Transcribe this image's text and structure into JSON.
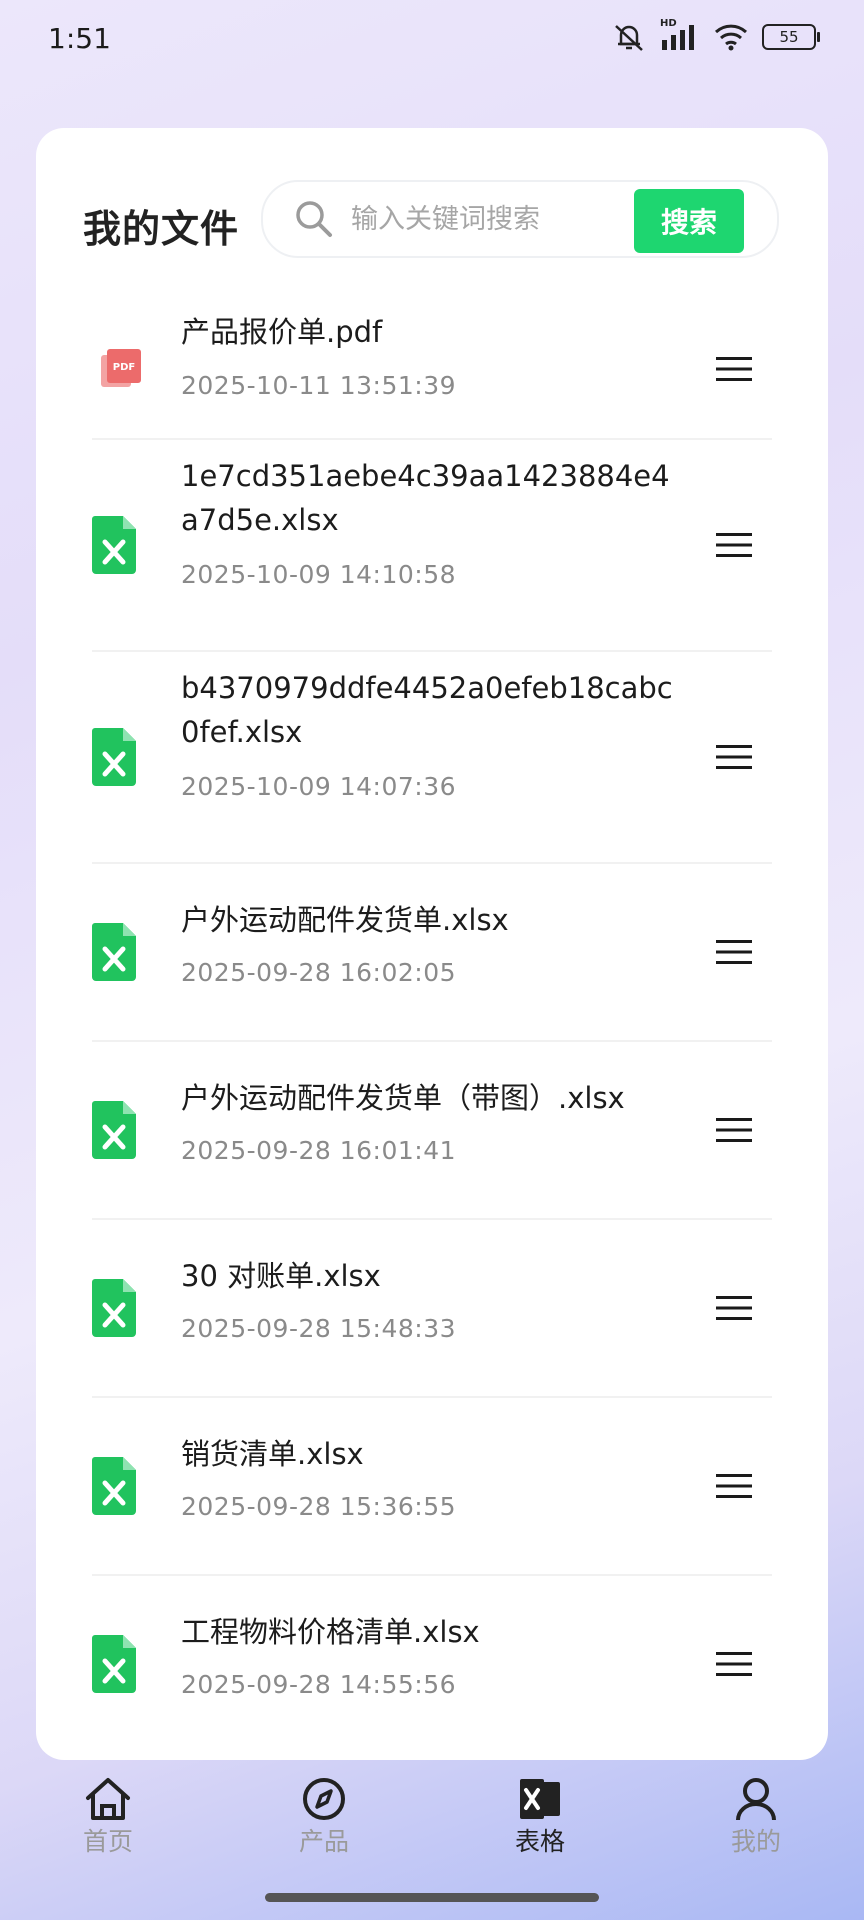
{
  "status_bar": {
    "time": "1:51",
    "battery": "55",
    "network": "HD"
  },
  "header": {
    "title": "我的文件",
    "search_placeholder": "输入关键词搜索",
    "search_button": "搜索"
  },
  "files": [
    {
      "name": "产品报价单.pdf",
      "date": "2025-10-11 13:51:39",
      "type": "pdf"
    },
    {
      "name": "1e7cd351aebe4c39aa1423884e4a7d5e.xlsx",
      "date": "2025-10-09 14:10:58",
      "type": "xlsx"
    },
    {
      "name": "b4370979ddfe4452a0efeb18cabc0fef.xlsx",
      "date": "2025-10-09 14:07:36",
      "type": "xlsx"
    },
    {
      "name": "户外运动配件发货单.xlsx",
      "date": "2025-09-28 16:02:05",
      "type": "xlsx"
    },
    {
      "name": "户外运动配件发货单（带图）.xlsx",
      "date": "2025-09-28 16:01:41",
      "type": "xlsx"
    },
    {
      "name": "30 对账单.xlsx",
      "date": "2025-09-28 15:48:33",
      "type": "xlsx"
    },
    {
      "name": "销货清单.xlsx",
      "date": "2025-09-28 15:36:55",
      "type": "xlsx"
    },
    {
      "name": "工程物料价格清单.xlsx",
      "date": "2025-09-28 14:55:56",
      "type": "xlsx"
    }
  ],
  "tabs": [
    {
      "label": "首页",
      "icon": "home-icon",
      "active": false
    },
    {
      "label": "产品",
      "icon": "compass-icon",
      "active": false
    },
    {
      "label": "表格",
      "icon": "excel-icon",
      "active": true
    },
    {
      "label": "我的",
      "icon": "user-icon",
      "active": false
    }
  ],
  "colors": {
    "accent": "#1ed670",
    "excel": "#21c35e",
    "pdf": "#ec6b6b"
  }
}
